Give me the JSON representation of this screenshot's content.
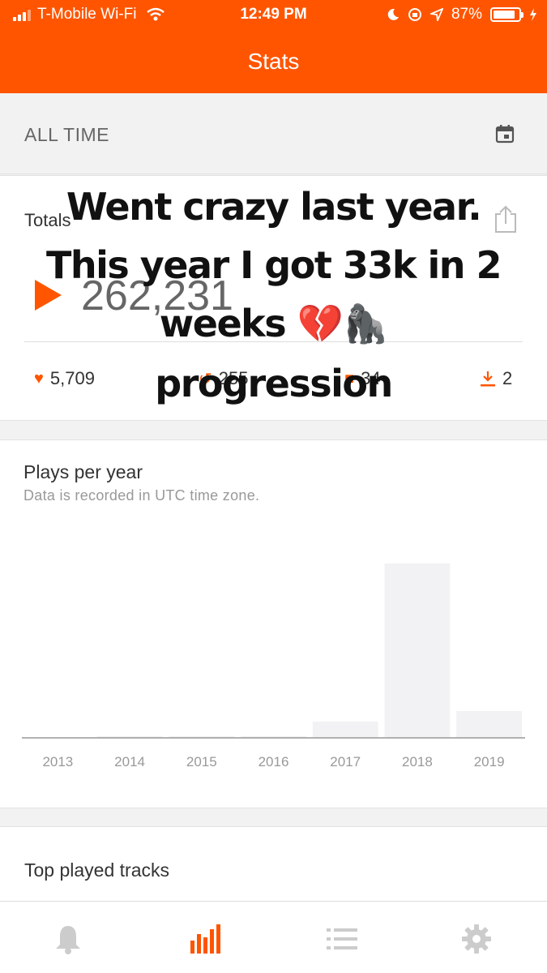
{
  "status_bar": {
    "carrier": "T-Mobile Wi-Fi",
    "time": "12:49 PM",
    "battery": "87%",
    "battery_level": 0.87
  },
  "nav": {
    "title": "Stats"
  },
  "range": {
    "label": "ALL TIME",
    "icon": "calendar-icon"
  },
  "totals": {
    "label": "Totals",
    "plays": "262,231",
    "likes": "5,709",
    "reposts": "255",
    "comments": "34",
    "downloads": "2"
  },
  "overlay": {
    "line1": "Went crazy last year.",
    "line2": "This year I got 33k in 2",
    "line3": "weeks 💔🦍",
    "line4": "progression"
  },
  "chart_data": {
    "type": "bar",
    "title": "Plays per year",
    "subtitle": "Data is recorded in UTC time zone.",
    "categories": [
      "2013",
      "2014",
      "2015",
      "2016",
      "2017",
      "2018",
      "2019"
    ],
    "values": [
      0,
      1200,
      1400,
      1000,
      20000,
      215000,
      33000
    ],
    "ylim": [
      0,
      215000
    ],
    "color": "#f2f1f3",
    "grid": false
  },
  "tracks": {
    "title": "Top played tracks"
  },
  "tab_bar": {
    "active_color": "#ff5500",
    "inactive_color": "#cccccc",
    "icons": [
      "bell-icon",
      "stats-icon",
      "list-icon",
      "gear-icon"
    ]
  }
}
